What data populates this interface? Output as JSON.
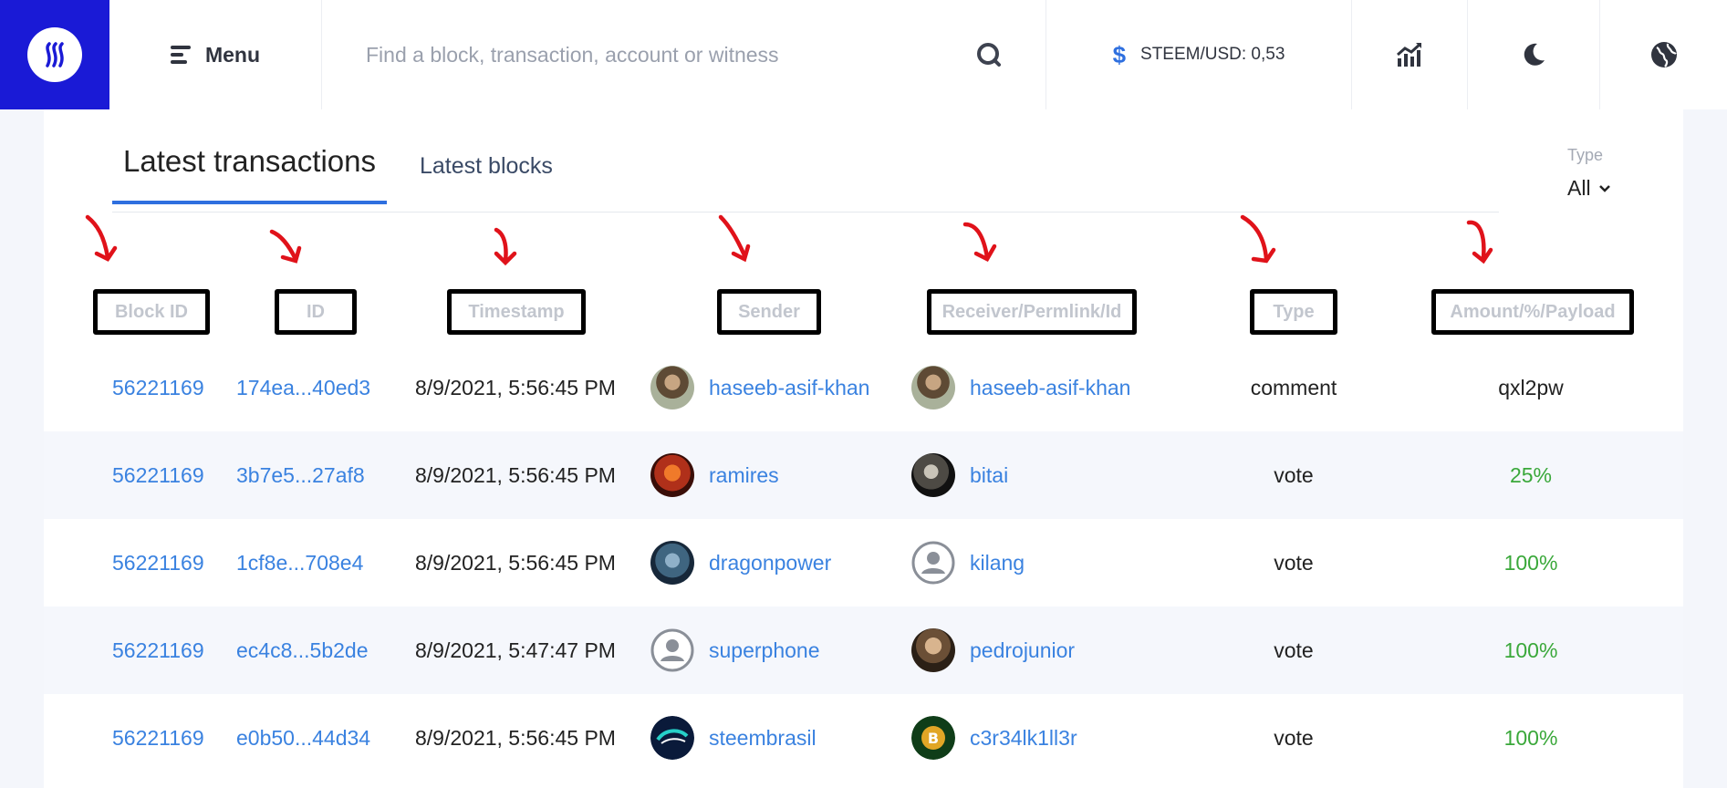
{
  "header": {
    "menu_label": "Menu",
    "search_placeholder": "Find a block, transaction, account or witness",
    "price_label": "STEEM/USD: 0,53",
    "colors": {
      "logo_bg": "#1a1ad6",
      "accent": "#2e6fdf"
    }
  },
  "tabs": [
    {
      "label": "Latest transactions",
      "active": true
    },
    {
      "label": "Latest blocks",
      "active": false
    }
  ],
  "type_filter": {
    "label": "Type",
    "value": "All"
  },
  "columns": [
    "Block ID",
    "ID",
    "Timestamp",
    "Sender",
    "Receiver/Permlink/Id",
    "Type",
    "Amount/%/Payload"
  ],
  "rows": [
    {
      "block_id": "56221169",
      "id": "174ea...40ed3",
      "timestamp": "8/9/2021, 5:56:45 PM",
      "sender": "haseeb-asif-khan",
      "receiver": "haseeb-asif-khan",
      "type": "comment",
      "amount": "qxl2pw"
    },
    {
      "block_id": "56221169",
      "id": "3b7e5...27af8",
      "timestamp": "8/9/2021, 5:56:45 PM",
      "sender": "ramires",
      "receiver": "bitai",
      "type": "vote",
      "amount": "25%"
    },
    {
      "block_id": "56221169",
      "id": "1cf8e...708e4",
      "timestamp": "8/9/2021, 5:56:45 PM",
      "sender": "dragonpower",
      "receiver": "kilang",
      "type": "vote",
      "amount": "100%"
    },
    {
      "block_id": "56221169",
      "id": "ec4c8...5b2de",
      "timestamp": "8/9/2021, 5:47:47 PM",
      "sender": "superphone",
      "receiver": "pedrojunior",
      "type": "vote",
      "amount": "100%"
    },
    {
      "block_id": "56221169",
      "id": "e0b50...44d34",
      "timestamp": "8/9/2021, 5:56:45 PM",
      "sender": "steembrasil",
      "receiver": "c3r34lk1ll3r",
      "type": "vote",
      "amount": "100%"
    }
  ]
}
